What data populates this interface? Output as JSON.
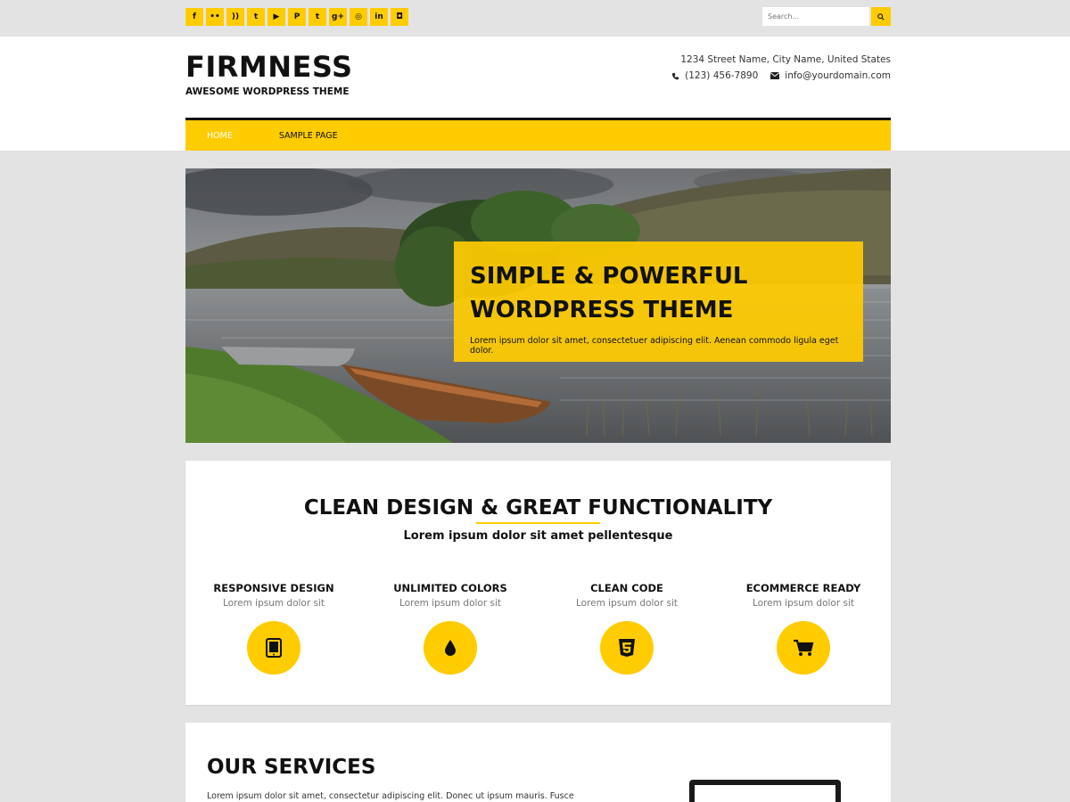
{
  "topbar": {
    "social_icons": [
      {
        "name": "facebook-icon",
        "glyph": "f"
      },
      {
        "name": "flickr-icon",
        "glyph": "••"
      },
      {
        "name": "rss-icon",
        "glyph": "))"
      },
      {
        "name": "twitter-icon",
        "glyph": "t"
      },
      {
        "name": "youtube-icon",
        "glyph": "▶"
      },
      {
        "name": "pinterest-icon",
        "glyph": "P"
      },
      {
        "name": "tumblr-icon",
        "glyph": "t"
      },
      {
        "name": "googleplus-icon",
        "glyph": "g+"
      },
      {
        "name": "dribbble-icon",
        "glyph": "◎"
      },
      {
        "name": "linkedin-icon",
        "glyph": "in"
      },
      {
        "name": "instagram-icon",
        "glyph": "◘"
      }
    ],
    "search_placeholder": "Search..."
  },
  "header": {
    "site_title": "FIRMNESS",
    "tagline": "AWESOME WORDPRESS THEME",
    "address": "1234 Street Name, City Name, United States",
    "phone": "(123) 456-7890",
    "email": "info@yourdomain.com"
  },
  "nav": {
    "items": [
      {
        "label": "HOME",
        "active": true
      },
      {
        "label": "SAMPLE PAGE",
        "active": false
      }
    ]
  },
  "hero": {
    "title_line1": "SIMPLE & POWERFUL",
    "title_line2": "WORDPRESS THEME",
    "text": "Lorem ipsum dolor sit amet, consectetuer adipiscing elit. Aenean commodo ligula eget dolor."
  },
  "features": {
    "title": "CLEAN DESIGN & GREAT FUNCTIONALITY",
    "subtitle": "Lorem ipsum dolor sit amet pellentesque",
    "items": [
      {
        "heading": "RESPONSIVE DESIGN",
        "text": "Lorem ipsum dolor sit",
        "icon": "tablet-icon"
      },
      {
        "heading": "UNLIMITED COLORS",
        "text": "Lorem ipsum dolor sit",
        "icon": "drop-icon"
      },
      {
        "heading": "CLEAN CODE",
        "text": "Lorem ipsum dolor sit",
        "icon": "html5-icon"
      },
      {
        "heading": "ECOMMERCE READY",
        "text": "Lorem ipsum dolor sit",
        "icon": "cart-icon"
      }
    ]
  },
  "services": {
    "title": "OUR SERVICES",
    "text": "Lorem ipsum dolor sit amet, consectetur adipiscing elit. Donec ut ipsum mauris. Fusce"
  },
  "colors": {
    "accent": "#ffcc00",
    "background": "#e3e3e3",
    "text": "#111111"
  }
}
